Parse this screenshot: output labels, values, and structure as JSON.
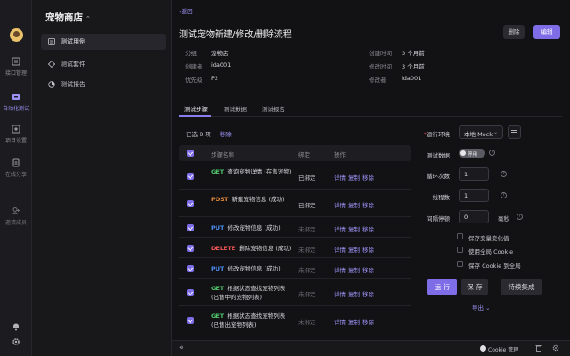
{
  "rail": {
    "items": [
      {
        "label": "接口管理",
        "icon": "api-doc-icon",
        "active": false
      },
      {
        "label": "自动化测试",
        "icon": "automation-icon",
        "active": true
      },
      {
        "label": "项目设置",
        "icon": "project-settings-icon",
        "active": false
      },
      {
        "label": "在线分享",
        "icon": "share-icon",
        "active": false
      },
      {
        "label": "邀请成员",
        "icon": "invite-member-icon",
        "active": false
      }
    ]
  },
  "sidenav": {
    "project_name": "宠物商店",
    "project_chevron": "⌃",
    "items": [
      {
        "label": "测试用例",
        "active": true
      },
      {
        "label": "测试套件",
        "active": false
      },
      {
        "label": "测试报告",
        "active": false
      }
    ]
  },
  "header": {
    "back_label": "返回",
    "title": "测试宠物新建/修改/删除流程",
    "delete_label": "删除",
    "edit_label": "编辑"
  },
  "meta": {
    "group_key": "分组",
    "group_val": "宠物店",
    "creator_key": "创建者",
    "creator_val": "ida001",
    "priority_key": "优先级",
    "priority_val": "P2",
    "created_key": "创建时间",
    "created_val": "3 个月前",
    "modified_key": "修改时间",
    "modified_val": "3 个月前",
    "modifier_key": "修改者",
    "modifier_val": "ida001"
  },
  "tabs": [
    "测试步骤",
    "测试数据",
    "测试报告"
  ],
  "steps": {
    "selected_text": "已选 8 项",
    "remove_label": "移除",
    "headers": {
      "name": "步骤名称",
      "bind": "绑定",
      "ops": "操作"
    },
    "ops": {
      "detail": "详情",
      "copy": "复制",
      "remove": "移除"
    },
    "rows": [
      {
        "method": "GET",
        "name": "查询宠物详情 (在售宠物)",
        "bind": "已绑定"
      },
      {
        "method": "POST",
        "name": "新建宠物信息 (成功)",
        "bind": "已绑定"
      },
      {
        "method": "PUT",
        "name": "修改宠物信息 (成功)",
        "bind": "未绑定"
      },
      {
        "method": "DELETE",
        "name": "删除宠物信息 (成功)",
        "bind": "未绑定"
      },
      {
        "method": "PUT",
        "name": "修改宠物信息 (成功)",
        "bind": "未绑定"
      },
      {
        "method": "GET",
        "name": "根据状态查找宠物列表 (出售中的宠物列表)",
        "bind": "未绑定"
      },
      {
        "method": "GET",
        "name": "根据状态查找宠物列表 (已售出宠物列表)",
        "bind": "未绑定"
      }
    ]
  },
  "config": {
    "env_label": "运行环境",
    "env_value": "本地 Mock",
    "env_dropdown": "⌄",
    "data_label": "测试数据",
    "data_toggle": "停用",
    "loop_label": "循环次数",
    "loop_value": "1",
    "threads_label": "线程数",
    "threads_value": "1",
    "interval_label": "间隔停顿",
    "interval_value": "0",
    "interval_unit": "毫秒",
    "options": [
      "保存变量变化值",
      "使用全局 Cookie",
      "保存 Cookie 到全局"
    ],
    "run_label": "运 行",
    "save_label": "保 存",
    "ci_label": "持续集成",
    "export_label": "导出 ⌄"
  },
  "footer": {
    "collapse": "«",
    "cookie_label": "Cookie 管理"
  },
  "colors": {
    "accent": "#7d6ee8",
    "get": "#4fc36b",
    "post": "#e88a3c",
    "put": "#4c8ef2",
    "delete": "#ef5656"
  }
}
